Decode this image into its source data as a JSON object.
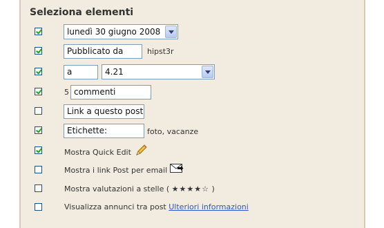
{
  "section_title": "Seleziona elementi",
  "date_row": {
    "checked": true,
    "select_value": "lunedì 30 giugno 2008"
  },
  "author_row": {
    "checked": true,
    "prefix_value": "Pubblicato da",
    "author": "hipst3r"
  },
  "time_row": {
    "checked": true,
    "prefix_value": "a",
    "select_value": "4.21"
  },
  "comments_row": {
    "checked": true,
    "count": "5",
    "value": "commenti"
  },
  "link_row": {
    "checked": false,
    "value": "Link a questo post"
  },
  "labels_row": {
    "checked": true,
    "value": "Etichette:",
    "labels": "foto, vacanze"
  },
  "quick_edit_row": {
    "checked": true,
    "label": "Mostra Quick Edit",
    "icon": "pencil-icon"
  },
  "email_row": {
    "checked": false,
    "label": "Mostra i link Post per email",
    "icon": "email-post-icon"
  },
  "rating_row": {
    "checked": false,
    "label": "Mostra valutazioni a stelle (",
    "stars": "★★★★☆",
    "suffix": ")"
  },
  "ads_row": {
    "checked": false,
    "label": "Visualizza annunci tra post",
    "link": "Ulteriori informazioni"
  },
  "colors": {
    "background": "#f2ebe0",
    "link": "#2a57c4",
    "check": "#21a121",
    "checkbox_border": "#1c5180"
  }
}
